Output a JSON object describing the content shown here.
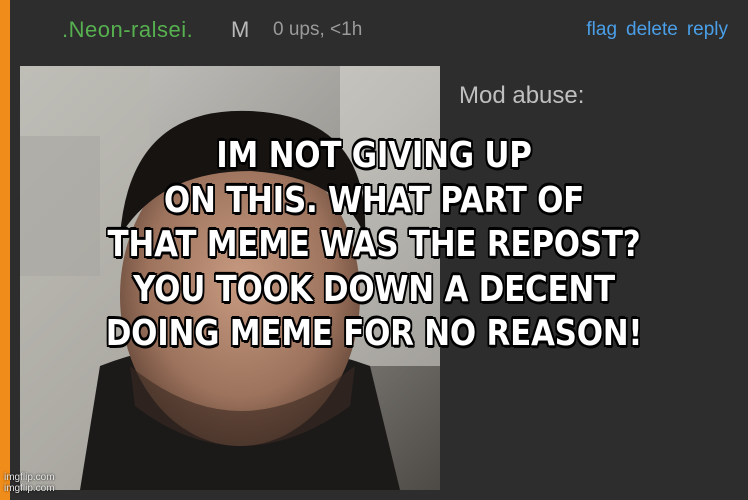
{
  "comment": {
    "username": ".Neon-ralsei.",
    "badge": "M",
    "meta": "0 ups, <1h",
    "actions": {
      "flag": "flag",
      "delete": "delete",
      "reply": "reply"
    },
    "mod_label": "Mod abuse:"
  },
  "meme": {
    "caption_lines": [
      "IM NOT GIVING UP",
      "ON THIS. WHAT PART OF",
      "THAT MEME WAS THE REPOST?",
      "YOU TOOK DOWN A DECENT",
      "DOING MEME FOR NO REASON!"
    ],
    "watermark_line1": "imgflip.com",
    "watermark_line2": "imgflip.com"
  },
  "colors": {
    "accent": "#f08c1a",
    "username": "#57b050",
    "link": "#4a9fe8",
    "background": "#2d2d2d"
  }
}
